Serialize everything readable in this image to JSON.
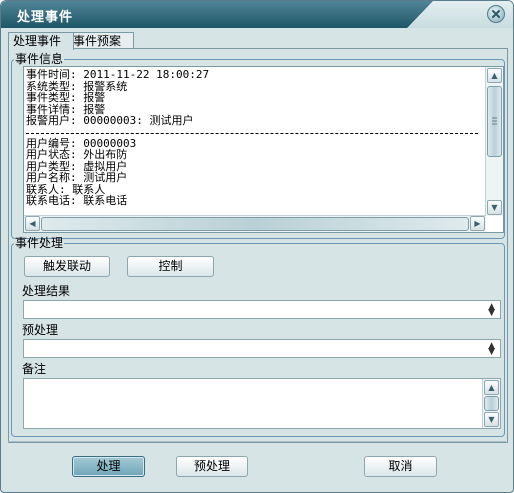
{
  "window": {
    "title": "处理事件"
  },
  "tabs": [
    {
      "label": "处理事件",
      "active": true
    },
    {
      "label": "事件预案",
      "active": false
    }
  ],
  "event_info": {
    "legend": "事件信息",
    "lines_top": [
      "事件时间: 2011-11-22 18:00:27",
      "系统类型: 报警系统",
      "事件类型: 报警",
      "事件详情: 报警",
      "报警用户: 00000003: 测试用户"
    ],
    "lines_bottom": [
      "用户编号: 00000003",
      "用户状态: 外出布防",
      "用户类型: 虚拟用户",
      "用户名称: 测试用户",
      "联系人: 联系人",
      "联系电话: 联系电话"
    ]
  },
  "event_handling": {
    "legend": "事件处理",
    "trigger_button": "触发联动",
    "control_button": "控制",
    "result_label": "处理结果",
    "result_value": "",
    "preprocess_label": "预处理",
    "preprocess_value": "",
    "notes_label": "备注",
    "notes_value": ""
  },
  "footer": {
    "process_button": "处理",
    "preprocess_button": "预处理",
    "cancel_button": "取消"
  },
  "colors": {
    "title_bar": "#1e5567",
    "window_bg": "#d7e4e6",
    "group_border": "#6d96b4",
    "primary_button": "#6ea5b8"
  }
}
